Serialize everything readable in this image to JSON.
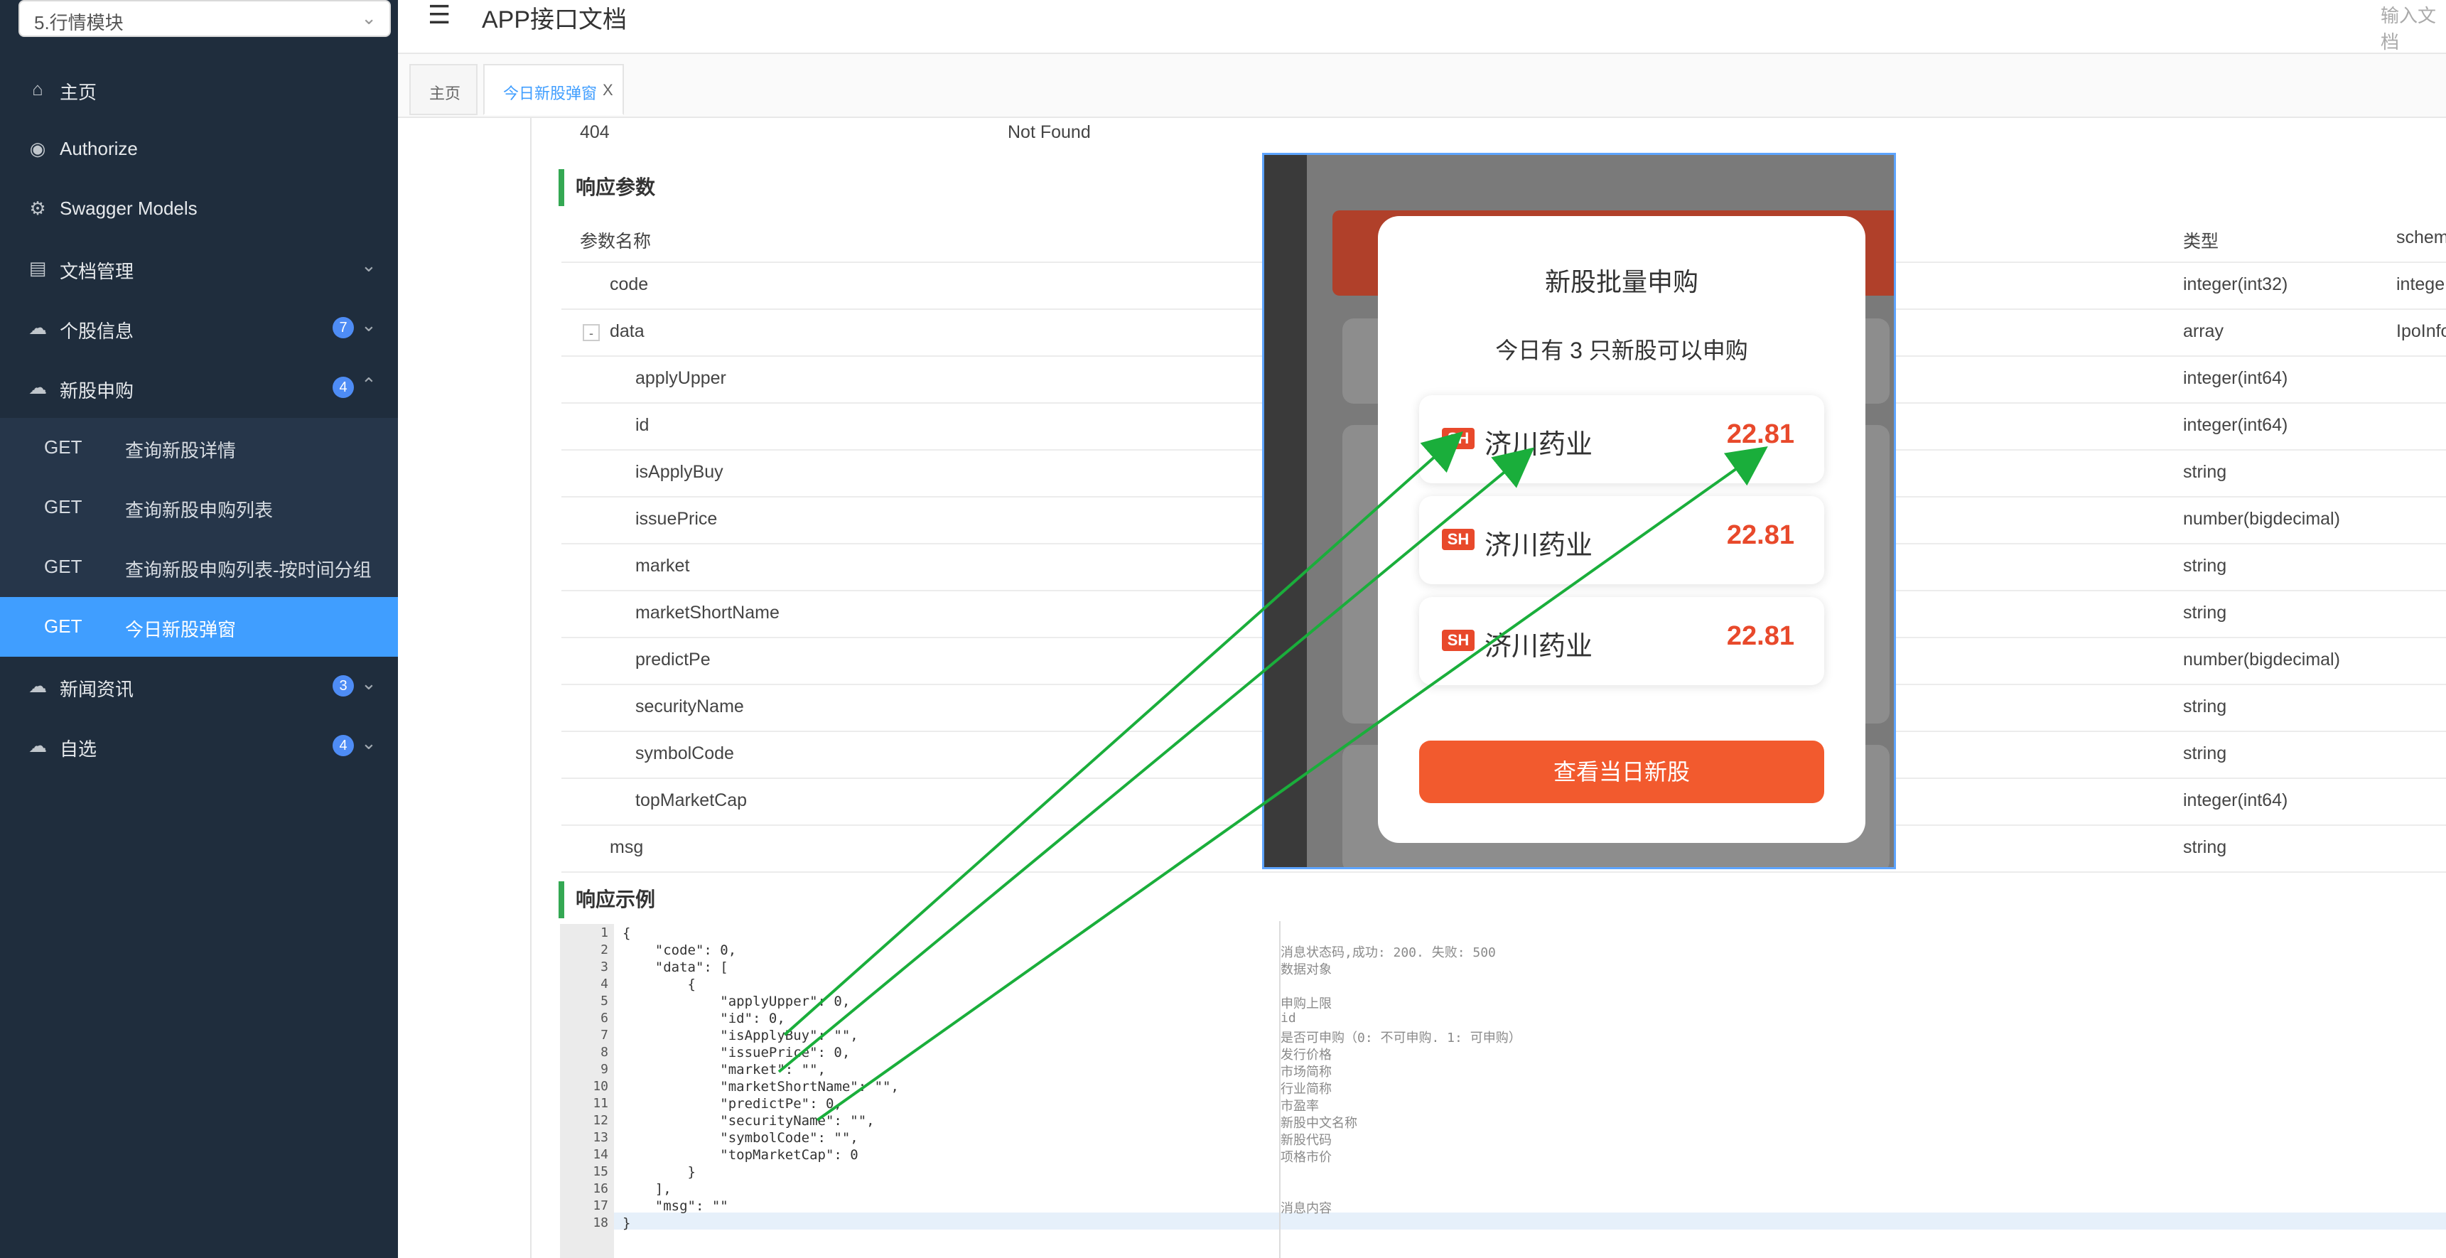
{
  "sidebar": {
    "module_select": "5.行情模块",
    "items": [
      {
        "label": "主页",
        "icon": "home-icon"
      },
      {
        "label": "Authorize",
        "icon": "lock-icon"
      },
      {
        "label": "Swagger Models",
        "icon": "gear-icon"
      },
      {
        "label": "文档管理",
        "icon": "doc-icon"
      },
      {
        "label": "个股信息",
        "icon": "cloud-icon",
        "badge": "7"
      },
      {
        "label": "新股申购",
        "icon": "cloud-icon",
        "badge": "4"
      },
      {
        "label": "新闻资讯",
        "icon": "cloud-icon",
        "badge": "3"
      },
      {
        "label": "自选",
        "icon": "cloud-icon",
        "badge": "4"
      }
    ],
    "sub_items": [
      {
        "method": "GET",
        "name": "查询新股详情"
      },
      {
        "method": "GET",
        "name": "查询新股申购列表"
      },
      {
        "method": "GET",
        "name": "查询新股申购列表-按时间分组"
      },
      {
        "method": "GET",
        "name": "今日新股弹窗"
      }
    ]
  },
  "header": {
    "title": "APP接口文档",
    "search_placeholder": "输入文档"
  },
  "tabs": [
    {
      "label": "主页"
    },
    {
      "label": "今日新股弹窗",
      "close": "X"
    }
  ],
  "status_row": {
    "code": "404",
    "desc": "Not Found"
  },
  "response_params": {
    "title": "响应参数",
    "headers": {
      "name": "参数名称",
      "type": "类型",
      "schema": "schem"
    },
    "rows": [
      {
        "name": "code",
        "type": "integer(int32)",
        "schema": "intege"
      },
      {
        "name": "data",
        "type": "array",
        "schema": "IpoInfo",
        "toggle": "-"
      },
      {
        "name": "applyUpper",
        "type": "integer(int64)",
        "schema": ""
      },
      {
        "name": "id",
        "type": "integer(int64)",
        "schema": ""
      },
      {
        "name": "isApplyBuy",
        "type": "string",
        "schema": ""
      },
      {
        "name": "issuePrice",
        "type": "number(bigdecimal)",
        "schema": ""
      },
      {
        "name": "market",
        "type": "string",
        "schema": ""
      },
      {
        "name": "marketShortName",
        "type": "string",
        "schema": ""
      },
      {
        "name": "predictPe",
        "type": "number(bigdecimal)",
        "schema": ""
      },
      {
        "name": "securityName",
        "type": "string",
        "schema": ""
      },
      {
        "name": "symbolCode",
        "type": "string",
        "schema": ""
      },
      {
        "name": "topMarketCap",
        "type": "integer(int64)",
        "schema": ""
      },
      {
        "name": "msg",
        "type": "string",
        "schema": ""
      }
    ]
  },
  "response_example": {
    "title": "响应示例",
    "lines": [
      "{",
      "    \"code\": 0,",
      "    \"data\": [",
      "        {",
      "            \"applyUpper\": 0,",
      "            \"id\": 0,",
      "            \"isApplyBuy\": \"\",",
      "            \"issuePrice\": 0,",
      "            \"market\": \"\",",
      "            \"marketShortName\": \"\",",
      "            \"predictPe\": 0,",
      "            \"securityName\": \"\",",
      "            \"symbolCode\": \"\",",
      "            \"topMarketCap\": 0",
      "        }",
      "    ],",
      "    \"msg\": \"\"",
      "}"
    ],
    "line_numbers": [
      "1",
      "2",
      "3",
      "4",
      "5",
      "6",
      "7",
      "8",
      "9",
      "10",
      "11",
      "12",
      "13",
      "14",
      "15",
      "16",
      "17",
      "18"
    ],
    "comments": [
      "",
      "消息状态码,成功: 200. 失败: 500",
      "数据对象",
      "",
      "申购上限",
      "id",
      "是否可申购（0: 不可申购. 1: 可申购）",
      "发行价格",
      "市场简称",
      "行业简称",
      "市盈率",
      "新股中文名称",
      "新股代码",
      "项格市价",
      "",
      "",
      "消息内容",
      ""
    ]
  },
  "popup": {
    "title": "新股批量申购",
    "subtitle": "今日有 3 只新股可以申购",
    "stocks": [
      {
        "market": "SH",
        "name": "济川药业",
        "price": "22.81"
      },
      {
        "market": "SH",
        "name": "济川药业",
        "price": "22.81"
      },
      {
        "market": "SH",
        "name": "济川药业",
        "price": "22.81"
      }
    ],
    "button": "查看当日新股"
  },
  "colors": {
    "sidebar_bg": "#1f2d3d",
    "active_blue": "#409eff",
    "section_accent": "#34a853",
    "popup_red": "#e8492b",
    "button_orange": "#f25a2e",
    "arrow_green": "#1aae3b"
  }
}
